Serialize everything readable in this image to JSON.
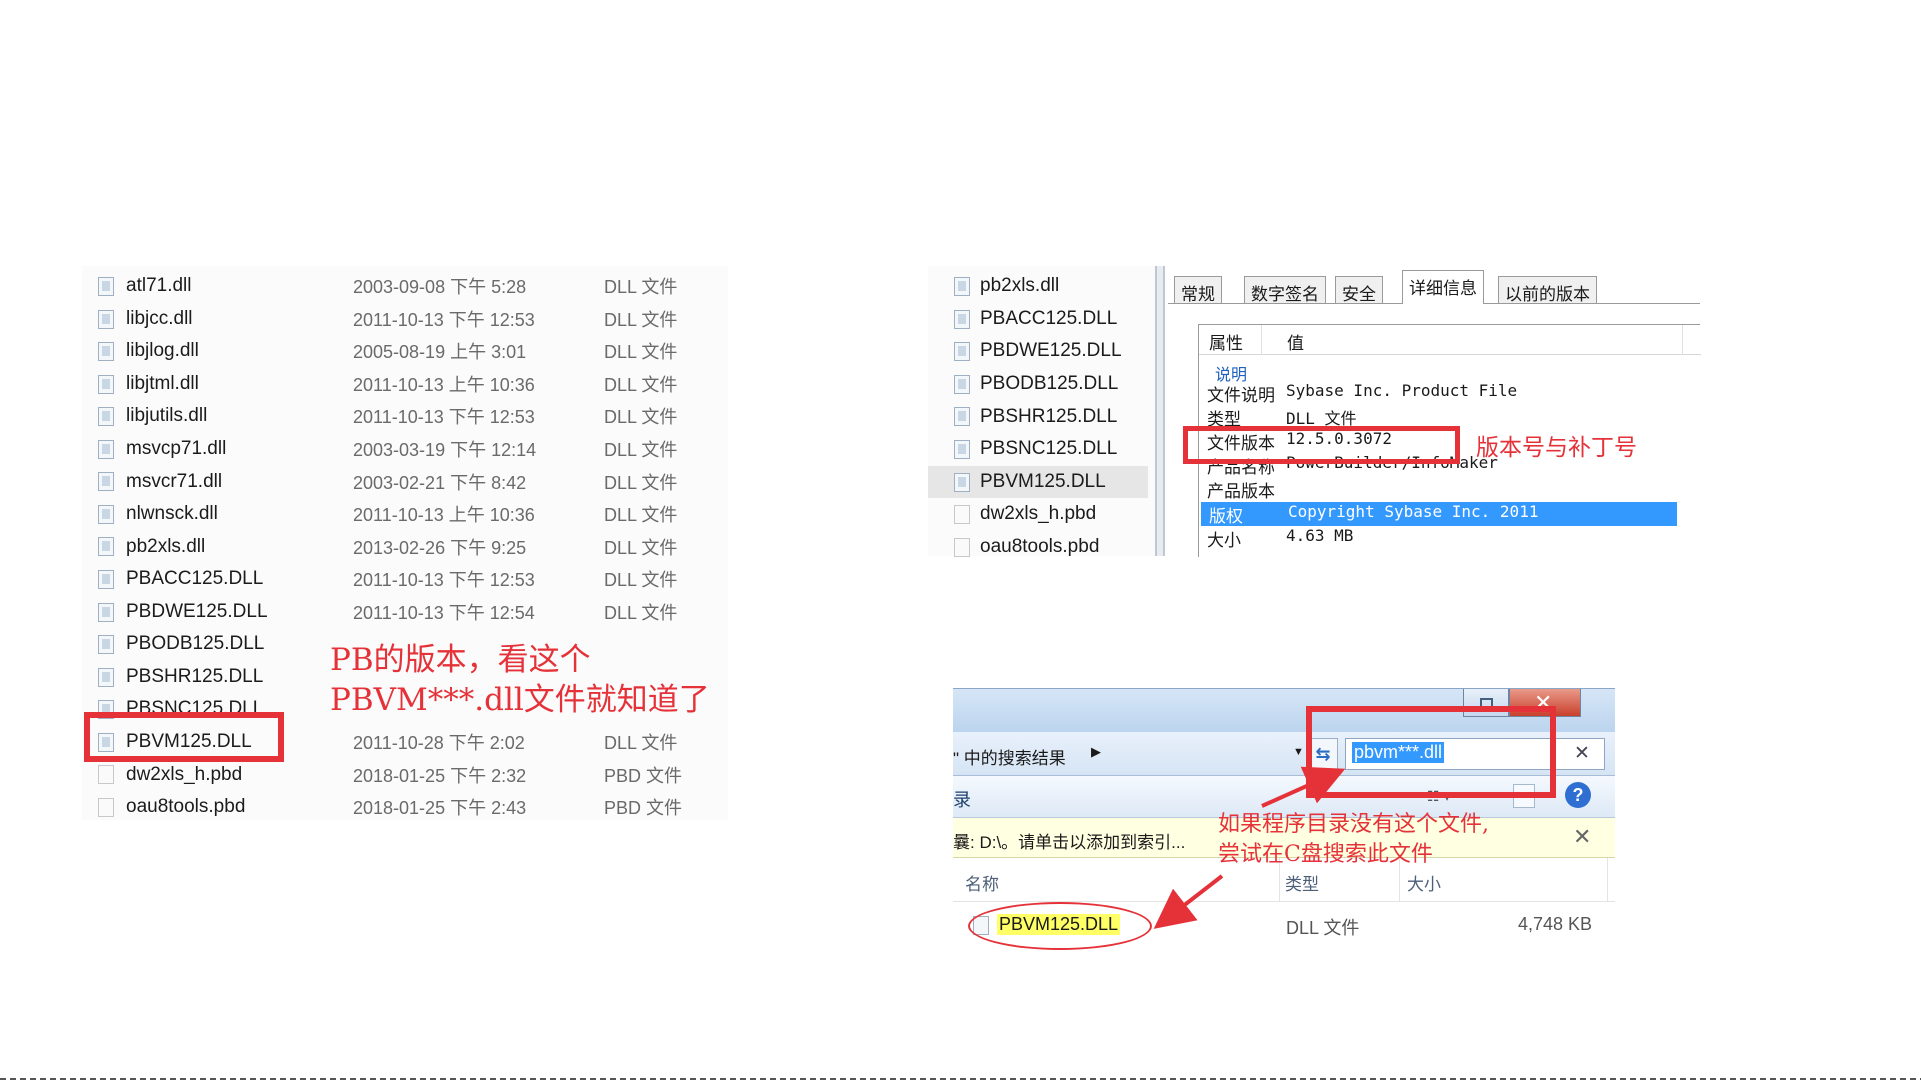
{
  "file_list": {
    "rows": [
      {
        "name": "atl71.dll",
        "date": "2003-09-08 下午 5:28",
        "type": "DLL 文件",
        "icon": "dll-file-icon"
      },
      {
        "name": "libjcc.dll",
        "date": "2011-10-13 下午 12:53",
        "type": "DLL 文件",
        "icon": "dll-file-icon"
      },
      {
        "name": "libjlog.dll",
        "date": "2005-08-19 上午 3:01",
        "type": "DLL 文件",
        "icon": "dll-file-icon"
      },
      {
        "name": "libjtml.dll",
        "date": "2011-10-13 上午 10:36",
        "type": "DLL 文件",
        "icon": "dll-file-icon"
      },
      {
        "name": "libjutils.dll",
        "date": "2011-10-13 下午 12:53",
        "type": "DLL 文件",
        "icon": "dll-file-icon"
      },
      {
        "name": "msvcp71.dll",
        "date": "2003-03-19 下午 12:14",
        "type": "DLL 文件",
        "icon": "dll-file-icon"
      },
      {
        "name": "msvcr71.dll",
        "date": "2003-02-21 下午 8:42",
        "type": "DLL 文件",
        "icon": "dll-file-icon"
      },
      {
        "name": "nlwnsck.dll",
        "date": "2011-10-13 上午 10:36",
        "type": "DLL 文件",
        "icon": "dll-file-icon"
      },
      {
        "name": "pb2xls.dll",
        "date": "2013-02-26 下午 9:25",
        "type": "DLL 文件",
        "icon": "dll-file-icon"
      },
      {
        "name": "PBACC125.DLL",
        "date": "2011-10-13 下午 12:53",
        "type": "DLL 文件",
        "icon": "dll-file-icon"
      },
      {
        "name": "PBDWE125.DLL",
        "date": "2011-10-13 下午 12:54",
        "type": "DLL 文件",
        "icon": "dll-file-icon"
      },
      {
        "name": "PBODB125.DLL",
        "date": "",
        "type": "",
        "icon": "dll-file-icon"
      },
      {
        "name": "PBSHR125.DLL",
        "date": "",
        "type": "",
        "icon": "dll-file-icon"
      },
      {
        "name": "PBSNC125.DLL",
        "date": "",
        "type": "",
        "icon": "dll-file-icon"
      },
      {
        "name": "PBVM125.DLL",
        "date": "2011-10-28 下午 2:02",
        "type": "DLL 文件",
        "icon": "dll-file-icon"
      },
      {
        "name": "dw2xls_h.pbd",
        "date": "2018-01-25 下午 2:32",
        "type": "PBD 文件",
        "icon": "pbd-file-icon"
      },
      {
        "name": "oau8tools.pbd",
        "date": "2018-01-25 下午 2:43",
        "type": "PBD 文件",
        "icon": "pbd-file-icon"
      }
    ],
    "annotation_line1": "PB的版本，看这个",
    "annotation_line2": "PBVM***.dll文件就知道了"
  },
  "properties": {
    "side_files": [
      "pb2xls.dll",
      "PBACC125.DLL",
      "PBDWE125.DLL",
      "PBODB125.DLL",
      "PBSHR125.DLL",
      "PBSNC125.DLL",
      "PBVM125.DLL",
      "dw2xls_h.pbd",
      "oau8tools.pbd"
    ],
    "tabs": [
      "常规",
      "数字签名",
      "安全",
      "详细信息",
      "以前的版本"
    ],
    "active_tab": "详细信息",
    "col_property": "属性",
    "col_value": "值",
    "section": "说明",
    "rows": [
      {
        "key": "文件说明",
        "value": "Sybase Inc. Product File"
      },
      {
        "key": "类型",
        "value": "DLL 文件"
      },
      {
        "key": "文件版本",
        "value": "12.5.0.3072"
      },
      {
        "key": "产品名称",
        "value": "PowerBuilder/InfoMaker"
      },
      {
        "key": "产品版本",
        "value": ""
      },
      {
        "key": "版权",
        "value": "Copyright Sybase Inc. 2011"
      },
      {
        "key": "大小",
        "value": "4.63 MB"
      }
    ],
    "annotation": "版本号与补丁号"
  },
  "search": {
    "breadcrumb": "\" 中的搜索结果",
    "query": "pbvm***.dll",
    "toolbar_label": "录",
    "info_bar": "曩: D:\\。请单击以添加到索引...",
    "annotation_line1": "如果程序目录没有这个文件,",
    "annotation_line2": "尝试在C盘搜索此文件",
    "columns": [
      "名称",
      "类型",
      "大小"
    ],
    "result": {
      "name": "PBVM125.DLL",
      "type": "DLL 文件",
      "size": "4,748 KB"
    }
  },
  "colors": {
    "annotation_red": "#e53239",
    "selection_blue": "#3399ff",
    "highlight_yellow": "#ffff66"
  }
}
